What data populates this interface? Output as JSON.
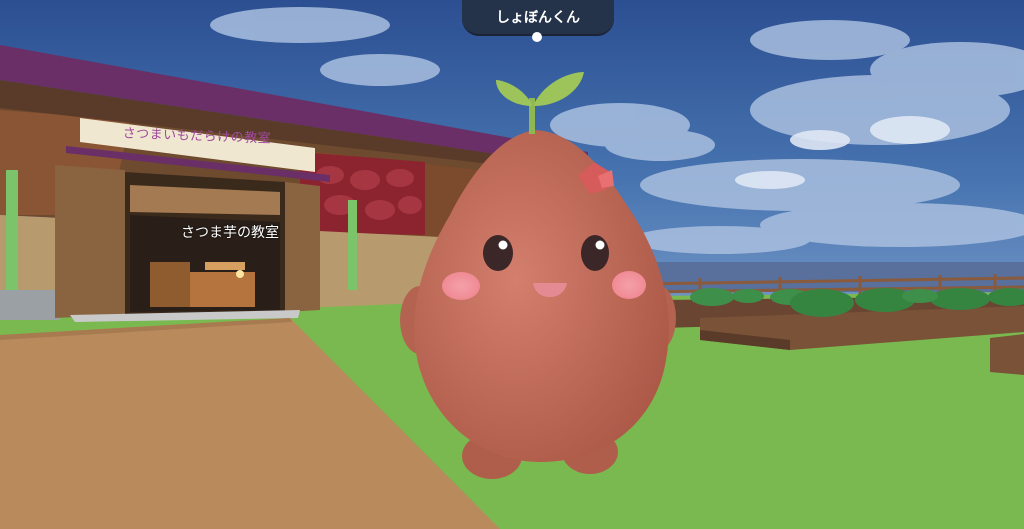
{
  "avatar": {
    "name": "しょぼんくん"
  },
  "building": {
    "sign_text": "さつまいもだらけの教室",
    "door_label": "さつま芋の教室"
  },
  "colors": {
    "sky": "#2f5596",
    "grass": "#79b94f",
    "path": "#b98a5c",
    "roof": "#6a2f67",
    "avatar_body": "#c46f5f",
    "leaf": "#9cc45a",
    "nameplate": "#24324a"
  }
}
